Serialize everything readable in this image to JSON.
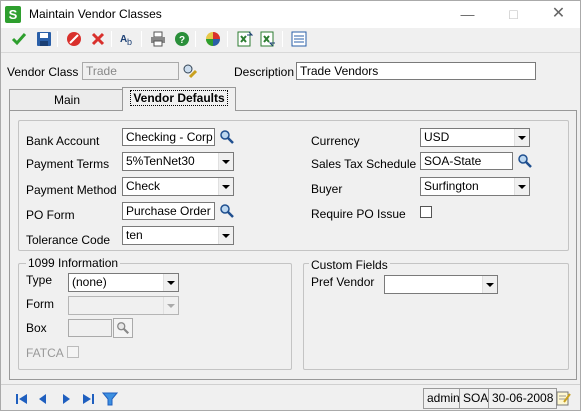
{
  "window": {
    "title": "Maintain Vendor Classes",
    "app_icon_letter": "S"
  },
  "header": {
    "vendor_class_label": "Vendor Class",
    "vendor_class_value": "Trade",
    "description_label": "Description",
    "description_value": "Trade Vendors"
  },
  "tabs": [
    {
      "label": "Main",
      "active": false
    },
    {
      "label": "Vendor Defaults",
      "active": true
    }
  ],
  "defaults": {
    "bank_account": {
      "label": "Bank Account",
      "value": "Checking - Corp"
    },
    "payment_terms": {
      "label": "Payment Terms",
      "value": "5%TenNet30"
    },
    "payment_method": {
      "label": "Payment Method",
      "value": "Check"
    },
    "po_form": {
      "label": "PO Form",
      "value": "Purchase Order"
    },
    "tolerance_code": {
      "label": "Tolerance Code",
      "value": "ten"
    },
    "currency": {
      "label": "Currency",
      "value": "USD"
    },
    "sales_tax_schedule": {
      "label": "Sales Tax Schedule",
      "value": "SOA-State"
    },
    "buyer": {
      "label": "Buyer",
      "value": "Surfington"
    },
    "require_po_issue": {
      "label": "Require PO Issue",
      "checked": false
    }
  },
  "info1099": {
    "title": "1099 Information",
    "type": {
      "label": "Type",
      "value": "(none)"
    },
    "form": {
      "label": "Form",
      "value": ""
    },
    "box": {
      "label": "Box",
      "value": ""
    },
    "fatca": {
      "label": "FATCA",
      "checked": false
    }
  },
  "custom_fields": {
    "title": "Custom Fields",
    "pref_vendor": {
      "label": "Pref Vendor",
      "value": ""
    }
  },
  "status": {
    "user": "admin",
    "company": "SOA",
    "date": "30-06-2008"
  },
  "colors": {
    "accept_green": "#2e9f2e",
    "cancel_red": "#d9302c",
    "nav_blue": "#1f5fbf"
  }
}
